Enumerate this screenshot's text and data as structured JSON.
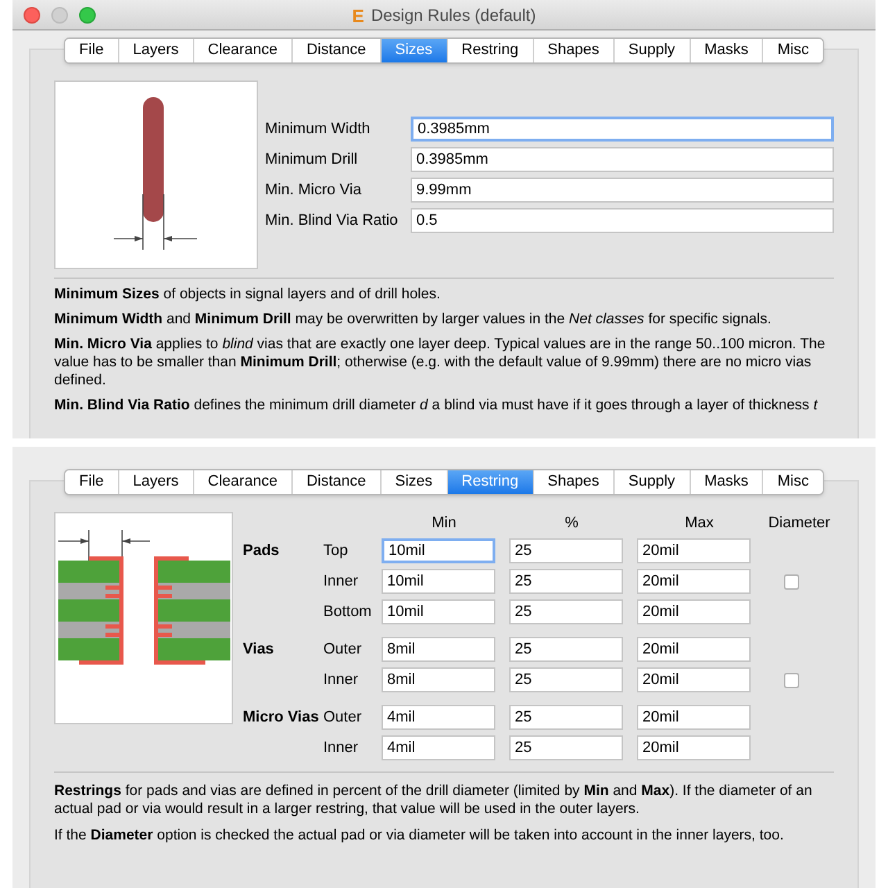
{
  "window": {
    "title": "Design Rules (default)",
    "logo": "E"
  },
  "sizes_page": {
    "tabs": [
      {
        "label": "File",
        "selected": false
      },
      {
        "label": "Layers",
        "selected": false
      },
      {
        "label": "Clearance",
        "selected": false
      },
      {
        "label": "Distance",
        "selected": false
      },
      {
        "label": "Sizes",
        "selected": true
      },
      {
        "label": "Restring",
        "selected": false
      },
      {
        "label": "Shapes",
        "selected": false
      },
      {
        "label": "Supply",
        "selected": false
      },
      {
        "label": "Masks",
        "selected": false
      },
      {
        "label": "Misc",
        "selected": false
      }
    ],
    "fields": [
      {
        "label": "Minimum Width",
        "value": "0.3985mm",
        "focused": true
      },
      {
        "label": "Minimum Drill",
        "value": "0.3985mm",
        "focused": false
      },
      {
        "label": "Min. Micro Via",
        "value": "9.99mm",
        "focused": false
      },
      {
        "label": "Min. Blind Via Ratio",
        "value": "0.5",
        "focused": false
      }
    ],
    "paragraphs": [
      "**Minimum Sizes** of objects in signal layers and of drill holes.",
      "**Minimum Width** and **Minimum Drill** may be overwritten by larger values in the *Net classes* for specific signals.",
      "**Min. Micro Via** applies to *blind* vias that are exactly one layer deep. Typical values are in the range 50..100 micron. The value has to be smaller than **Minimum Drill**; otherwise (e.g. with the default value of 9.99mm) there are no micro vias defined.",
      "**Min. Blind Via Ratio** defines the minimum drill diameter *d* a blind via must have if it goes through a layer of thickness *t*"
    ]
  },
  "restring_page": {
    "tabs": [
      {
        "label": "File",
        "selected": false
      },
      {
        "label": "Layers",
        "selected": false
      },
      {
        "label": "Clearance",
        "selected": false
      },
      {
        "label": "Distance",
        "selected": false
      },
      {
        "label": "Sizes",
        "selected": false
      },
      {
        "label": "Restring",
        "selected": true
      },
      {
        "label": "Shapes",
        "selected": false
      },
      {
        "label": "Supply",
        "selected": false
      },
      {
        "label": "Masks",
        "selected": false
      },
      {
        "label": "Misc",
        "selected": false
      }
    ],
    "columns": [
      "Min",
      "%",
      "Max",
      "Diameter"
    ],
    "groups": [
      {
        "label": "Pads",
        "rows": [
          {
            "label": "Top",
            "min": "10mil",
            "percent": "25",
            "max": "20mil",
            "focused": true
          },
          {
            "label": "Inner",
            "min": "10mil",
            "percent": "25",
            "max": "20mil",
            "focused": false,
            "diameter": {
              "checked": false
            }
          },
          {
            "label": "Bottom",
            "min": "10mil",
            "percent": "25",
            "max": "20mil",
            "focused": false
          }
        ]
      },
      {
        "label": "Vias",
        "rows": [
          {
            "label": "Outer",
            "min": "8mil",
            "percent": "25",
            "max": "20mil",
            "focused": false
          },
          {
            "label": "Inner",
            "min": "8mil",
            "percent": "25",
            "max": "20mil",
            "focused": false,
            "diameter": {
              "checked": false
            }
          }
        ]
      },
      {
        "label": "Micro Vias",
        "rows": [
          {
            "label": "Outer",
            "min": "4mil",
            "percent": "25",
            "max": "20mil",
            "focused": false
          },
          {
            "label": "Inner",
            "min": "4mil",
            "percent": "25",
            "max": "20mil",
            "focused": false
          }
        ]
      }
    ],
    "paragraphs": [
      "**Restrings** for pads and vias are defined in percent of the drill diameter (limited by **Min** and **Max**). If the diameter of an actual pad or via would result in a larger restring, that value will be used in the outer layers.",
      "If the **Diameter** option is checked the actual pad or via diameter will be taken into account in the inner layers, too."
    ]
  }
}
